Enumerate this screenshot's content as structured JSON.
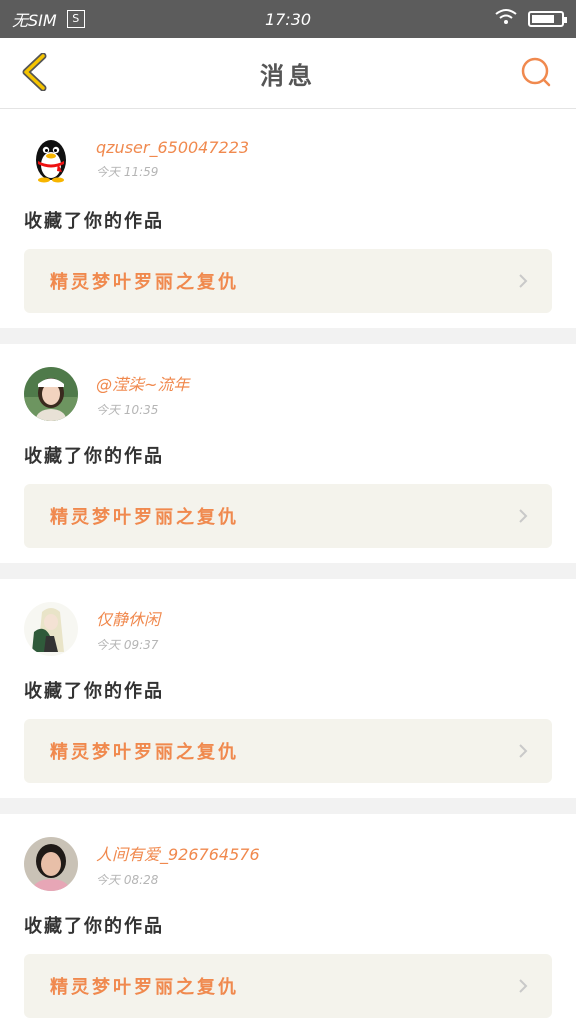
{
  "status_bar": {
    "carrier": "无SIM",
    "sim_icon_label": "S",
    "time": "17:30"
  },
  "header": {
    "title": "消息"
  },
  "messages": [
    {
      "username": "qzuser_650047223",
      "time": "今天 11:59",
      "action": "收藏了你的作品",
      "work_title": "精灵梦叶罗丽之复仇",
      "avatar": "penguin"
    },
    {
      "username": "@滢柒~流年",
      "time": "今天 10:35",
      "action": "收藏了你的作品",
      "work_title": "精灵梦叶罗丽之复仇",
      "avatar": "girl-photo"
    },
    {
      "username": "仅静休闲",
      "time": "今天 09:37",
      "action": "收藏了你的作品",
      "work_title": "精灵梦叶罗丽之复仇",
      "avatar": "anime-figure"
    },
    {
      "username": "人间有爱_926764576",
      "time": "今天 08:28",
      "action": "收藏了你的作品",
      "work_title": "精灵梦叶罗丽之复仇",
      "avatar": "woman-photo"
    }
  ],
  "colors": {
    "accent": "#f0894e",
    "status_bar": "#5c5c5c",
    "work_bg": "#f4f3ec",
    "back_arrow": "#f5c400"
  }
}
